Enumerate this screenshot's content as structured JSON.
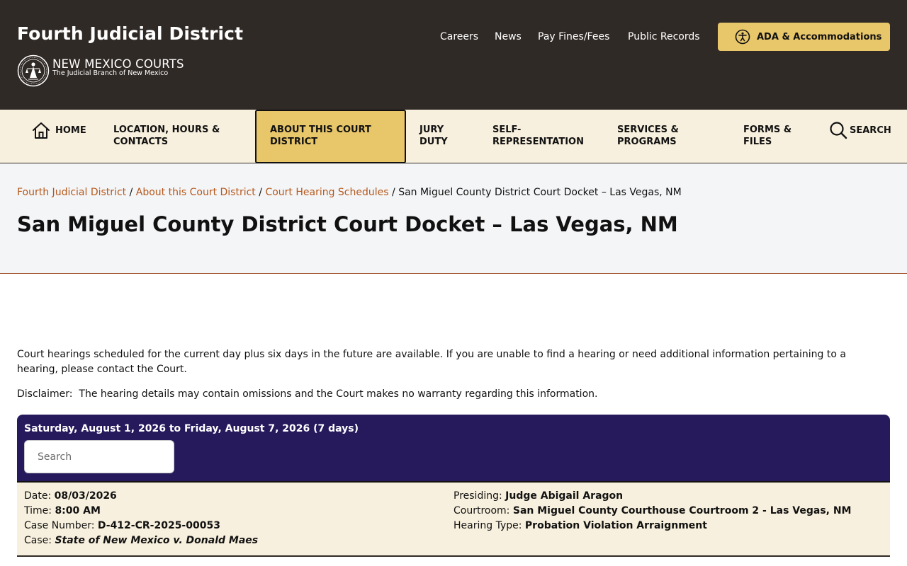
{
  "header": {
    "site_title": "Fourth Judicial District",
    "brand": "NEW MEXICO COURTS",
    "tagline": "The Judicial Branch of New Mexico",
    "utility_links": [
      "Careers",
      "News",
      "Pay Fines/Fees",
      "Public Records"
    ],
    "ada_label": "ADA & Accommodations",
    "colors": {
      "background": "#302a26",
      "accent": "#e8c66a"
    }
  },
  "nav": {
    "home": "HOME",
    "location": [
      "LOCATION, HOURS &",
      "CONTACTS"
    ],
    "about": [
      "ABOUT THIS COURT",
      "DISTRICT"
    ],
    "jury": [
      "JURY",
      "DUTY"
    ],
    "self_rep": [
      "SELF-",
      "REPRESENTATION"
    ],
    "services": [
      "SERVICES &",
      "PROGRAMS"
    ],
    "forms": [
      "FORMS &",
      "FILES"
    ],
    "search": "SEARCH",
    "active_item": "about"
  },
  "breadcrumb": {
    "items": [
      "Fourth Judicial District",
      "About this Court District",
      "Court Hearing Schedules"
    ],
    "current": "San Miguel County District Court Docket – Las Vegas, NM",
    "separator": "/"
  },
  "page_title": "San Miguel County District Court Docket – Las Vegas, NM",
  "intro": "Court hearings scheduled for the current day plus six days in the future are available. If you are unable to find a hearing or need additional information pertaining to a hearing, please contact the Court.",
  "disclaimer": "Disclaimer:  The hearing details may contain omissions and the Court makes no warranty regarding this information.",
  "docket": {
    "range": "Saturday, August 1, 2026 to Friday, August 7, 2026 (7 days)",
    "search_placeholder": "Search",
    "search_value": "",
    "header_color": "#261a5c"
  },
  "hearing": {
    "labels": {
      "date": "Date:",
      "time": "Time:",
      "case_number": "Case Number:",
      "case": "Case:",
      "presiding": "Presiding:",
      "courtroom": "Courtroom:",
      "hearing_type": "Hearing Type:"
    },
    "date": "08/03/2026",
    "time": "8:00 AM",
    "case_number": "D-412-CR-2025-00053",
    "case": "State of New Mexico v. Donald Maes",
    "presiding": "Judge Abigail Aragon",
    "courtroom": "San Miguel County Courthouse Courtroom 2 - Las Vegas, NM",
    "hearing_type": "Probation Violation Arraignment"
  }
}
